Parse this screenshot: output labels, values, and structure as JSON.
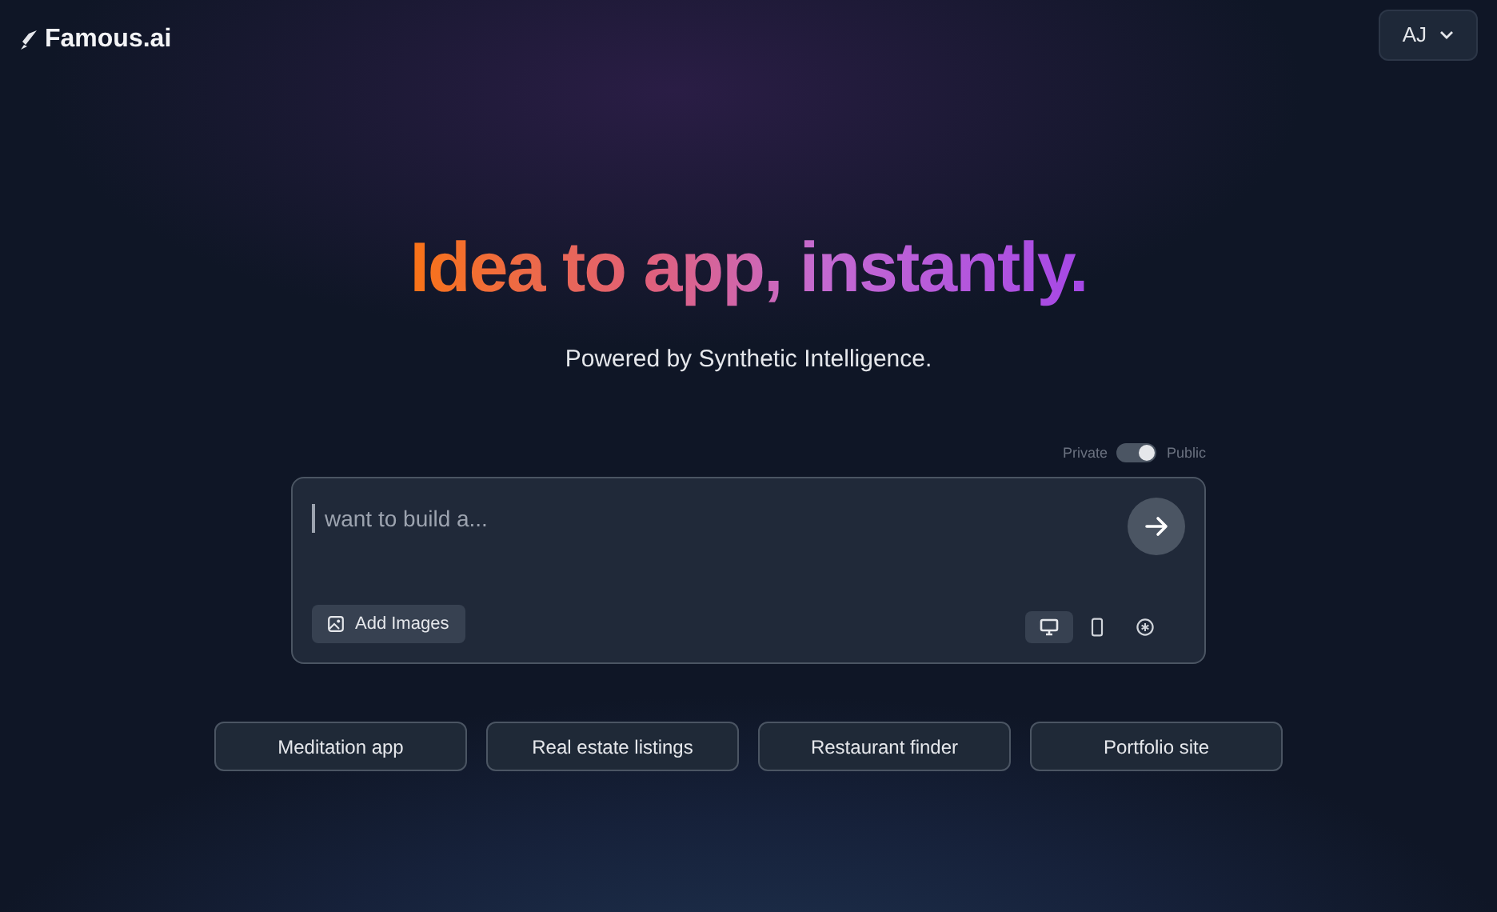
{
  "brand": "Famous.ai",
  "user": {
    "initials": "AJ"
  },
  "headline": "Idea to app, instantly.",
  "subtitle": "Powered by Synthetic Intelligence.",
  "visibility": {
    "off_label": "Private",
    "on_label": "Public",
    "on": true
  },
  "prompt": {
    "placeholder": "want to build a..."
  },
  "add_images": "Add Images",
  "platforms": [
    {
      "kind": "desktop",
      "selected": true
    },
    {
      "kind": "mobile",
      "selected": false
    },
    {
      "kind": "other",
      "selected": false
    }
  ],
  "suggestions": [
    "Meditation app",
    "Real estate listings",
    "Restaurant finder",
    "Portfolio site"
  ]
}
